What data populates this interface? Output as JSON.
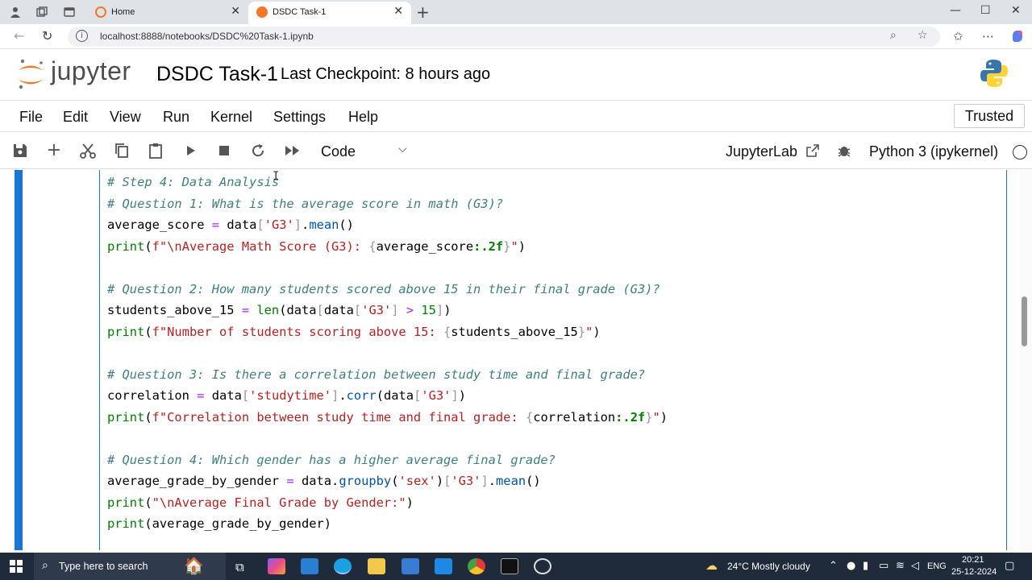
{
  "browser": {
    "tabs": [
      {
        "label": "Home",
        "icon": "jupyter-favicon-icon"
      },
      {
        "label": "DSDC Task-1",
        "icon": "jupyter-favicon-icon"
      }
    ],
    "url": "localhost:8888/notebooks/DSDC%20Task-1.ipynb",
    "window_controls": {
      "minimize": "—",
      "maximize": "☐",
      "close": "✕"
    }
  },
  "header": {
    "logo_text": "jupyter",
    "notebook_title": "DSDC Task-1",
    "checkpoint": "Last Checkpoint: 8 hours ago"
  },
  "menu": {
    "items": [
      "File",
      "Edit",
      "View",
      "Run",
      "Kernel",
      "Settings",
      "Help"
    ],
    "trusted": "Trusted"
  },
  "toolbar": {
    "cell_type": "Code",
    "jupyterlab_link": "JupyterLab",
    "kernel": "Python 3 (ipykernel)"
  },
  "cell": {
    "lines": [
      "# Step 4: Data Analysis",
      "# Question 1: What is the average score in math (G3)?",
      "average_score = data['G3'].mean()",
      "print(f\"\\nAverage Math Score (G3): {average_score:.2f}\")",
      "",
      "# Question 2: How many students scored above 15 in their final grade (G3)?",
      "students_above_15 = len(data[data['G3'] > 15])",
      "print(f\"Number of students scoring above 15: {students_above_15}\")",
      "",
      "# Question 3: Is there a correlation between study time and final grade?",
      "correlation = data['studytime'].corr(data['G3'])",
      "print(f\"Correlation between study time and final grade: {correlation:.2f}\")",
      "",
      "# Question 4: Which gender has a higher average final grade?",
      "average_grade_by_gender = data.groupby('sex')['G3'].mean()",
      "print(\"\\nAverage Final Grade by Gender:\")",
      "print(average_grade_by_gender)"
    ]
  },
  "taskbar": {
    "search_placeholder": "Type here to search",
    "weather": "24°C  Mostly cloudy",
    "language": "ENG",
    "time": "20:21",
    "date": "25-12-2024"
  }
}
